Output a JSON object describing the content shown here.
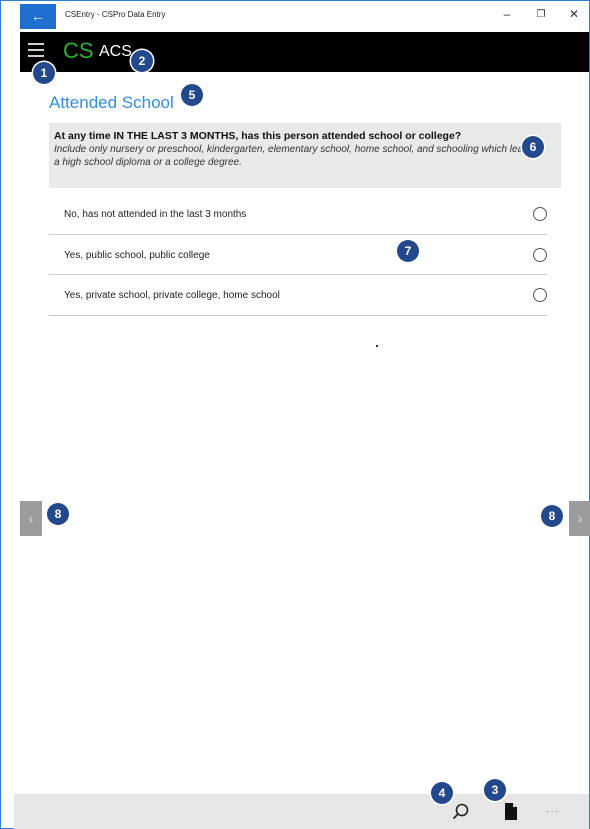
{
  "window": {
    "title": "CSEntry - CSPro Data Entry",
    "back_glyph": "←",
    "minimize_glyph": "–",
    "restore_glyph": "❐",
    "close_glyph": "✕"
  },
  "appbar": {
    "logo": "CS",
    "app_name": "ACS",
    "logo_color": "#2fb02f",
    "background": "#000000"
  },
  "field": {
    "title": "Attended School",
    "title_color": "#2f8fe0",
    "question": "At any time IN THE LAST 3 MONTHS, has this person attended school or college?",
    "help_text": "Include only nursery or preschool, kindergarten, elementary school, home school, and schooling which leads to a high school diploma or a college degree."
  },
  "options": [
    {
      "label": "No, has not attended in the last 3 months",
      "selected": false
    },
    {
      "label": "Yes, public school, public college",
      "selected": false
    },
    {
      "label": "Yes, private school, private college, home school",
      "selected": false
    }
  ],
  "navigation": {
    "prev_glyph": "‹",
    "next_glyph": "›"
  },
  "bottombar": {
    "icons": [
      "search-icon",
      "document-icon",
      "more-icon"
    ],
    "more_glyph": "···"
  },
  "callouts": [
    "1",
    "2",
    "3",
    "4",
    "5",
    "6",
    "7",
    "8",
    "8"
  ],
  "colors": {
    "accent": "#1f6fd0",
    "callout": "#23498c"
  }
}
